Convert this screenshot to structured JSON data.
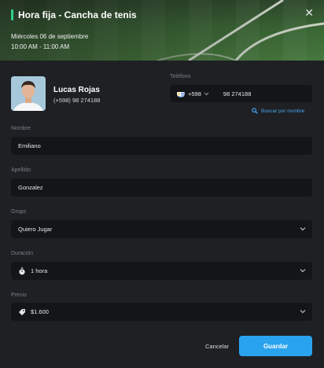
{
  "header": {
    "title": "Hora fija - Cancha de tenis",
    "date": "Miércoles 06 de septiembre",
    "time": "10:00 AM - 11:00 AM",
    "close_icon": "close-icon",
    "accent_color": "#2fd08a"
  },
  "user": {
    "name": "Lucas Rojas",
    "phone": "(+598) 98 274188"
  },
  "phone_field": {
    "label": "Teléfono",
    "country_code": "+598",
    "number": "98 274188",
    "flag_icon": "uruguay-flag-icon"
  },
  "search_link": {
    "label": "Buscar por nombre",
    "icon": "search-icon",
    "color": "#4aa3ea"
  },
  "form": {
    "first_name": {
      "label": "Nombre",
      "value": "Emiliano"
    },
    "last_name": {
      "label": "Apellido",
      "value": "Gonzalez"
    },
    "group": {
      "label": "Grupo",
      "value": "Quiero Jugar"
    },
    "duration": {
      "label": "Duración",
      "value": "1 hora",
      "icon": "stopwatch-icon"
    },
    "price": {
      "label": "Precio",
      "value": "$1.600",
      "icon": "price-tag-icon"
    }
  },
  "actions": {
    "cancel_label": "Cancelar",
    "save_label": "Guardar",
    "save_color": "#2aa3ef"
  }
}
